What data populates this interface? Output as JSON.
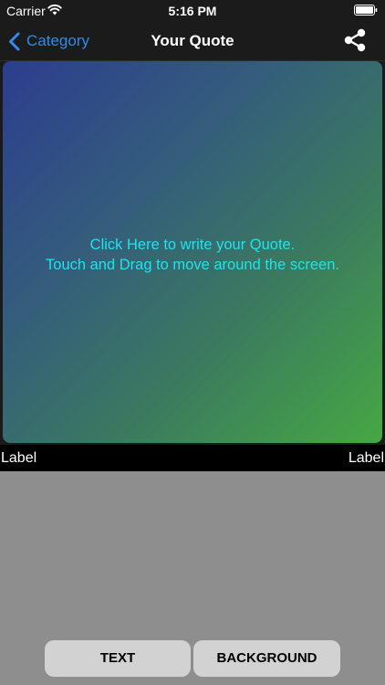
{
  "status_bar": {
    "carrier": "Carrier",
    "time": "5:16 PM"
  },
  "nav": {
    "back_label": "Category",
    "title": "Your Quote",
    "share_icon": "share-icon"
  },
  "quote_area": {
    "line1": "Click Here to write your Quote.",
    "line2": "Touch and Drag to move around the screen.",
    "text_color": "#1fe3ee",
    "gradient_start": "#2c3d8f",
    "gradient_end": "#46a843"
  },
  "labels": {
    "left": "Label",
    "right": "Label"
  },
  "buttons": {
    "text": "TEXT",
    "background": "BACKGROUND"
  },
  "colors": {
    "accent": "#2d8cf0",
    "nav_background": "#1b1b1b",
    "panel_background": "#8e8e8e",
    "button_background": "#d2d2d2"
  }
}
